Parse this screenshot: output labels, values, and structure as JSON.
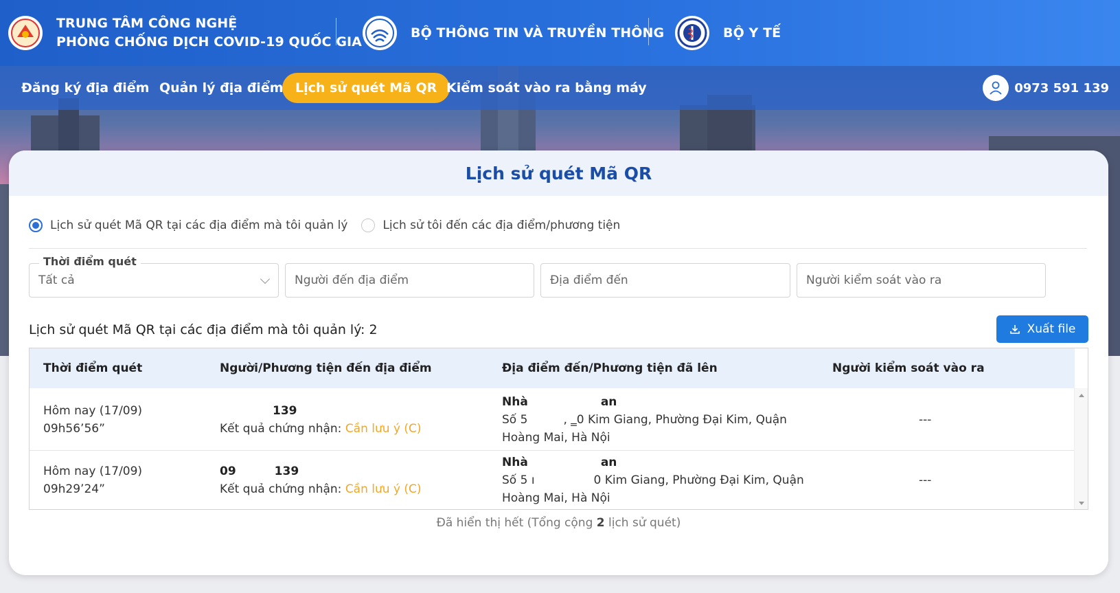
{
  "header": {
    "org1_line1": "TRUNG TÂM CÔNG NGHỆ",
    "org1_line2": "PHÒNG CHỐNG DỊCH COVID-19 QUỐC GIA",
    "org2": "BỘ THÔNG TIN VÀ TRUYỀN THÔNG",
    "org3": "BỘ Y TẾ"
  },
  "nav": {
    "items": [
      {
        "label": "Đăng ký địa điểm"
      },
      {
        "label": "Quản lý địa điểm"
      },
      {
        "label": "Lịch sử quét Mã QR",
        "active": true
      },
      {
        "label": "Kiểm soát vào ra bằng máy"
      }
    ],
    "user_phone": "0973 591 139"
  },
  "page": {
    "title": "Lịch sử quét Mã QR",
    "radio_options": [
      {
        "label": "Lịch sử quét Mã QR tại các địa điểm mà tôi quản lý",
        "selected": true
      },
      {
        "label": "Lịch sử tôi đến các địa điểm/phương tiện",
        "selected": false
      }
    ],
    "filters": {
      "time_legend": "Thời điểm quét",
      "time_value": "Tất cả",
      "person_placeholder": "Người đến địa điểm",
      "place_placeholder": "Địa điểm đến",
      "controller_placeholder": "Người kiểm soát vào ra"
    },
    "count_label": "Lịch sử quét Mã QR tại các địa điểm mà tôi quản lý: 2",
    "export_label": "Xuất file",
    "table": {
      "headers": [
        "Thời điểm quét",
        "Người/Phương tiện đến địa điểm",
        "Địa điểm đến/Phương tiện đã lên",
        "Người kiểm soát vào ra"
      ],
      "rows": [
        {
          "date": "Hôm nay (17/09)",
          "time": "09h56’56”",
          "person": "139",
          "result_label": "Kết quả chứng nhận:",
          "result_value": "Cần lưu ý (C)",
          "place_name_a": "Nhà",
          "place_name_b": "an",
          "addr_a": "Số 5",
          "addr_b": "‚ ‗0 Kim Giang, Phường Đại Kim, Quận",
          "addr_line2": "Hoàng Mai, Hà Nội",
          "controller": "---"
        },
        {
          "date": "Hôm nay (17/09)",
          "time": "09h29’24”",
          "person_a": "09",
          "person": "139",
          "result_label": "Kết quả chứng nhận:",
          "result_value": "Cần lưu ý (C)",
          "place_name_a": "Nhà",
          "place_name_b": "an",
          "addr_a": "Số 5 ı",
          "addr_b": "0 Kim Giang, Phường Đại Kim, Quận",
          "addr_line2": "Hoàng Mai, Hà Nội",
          "controller": "---"
        }
      ]
    },
    "footer_text_a": "Đã hiển thị hết (Tổng cộng ",
    "footer_count": "2",
    "footer_text_b": " lịch sử quét)"
  },
  "colors": {
    "header_blue": "#1f5fc9",
    "active_tab": "#f7b21a",
    "title_blue": "#1c4da6",
    "export_blue": "#1f7be0",
    "warning_orange": "#f2a726"
  }
}
